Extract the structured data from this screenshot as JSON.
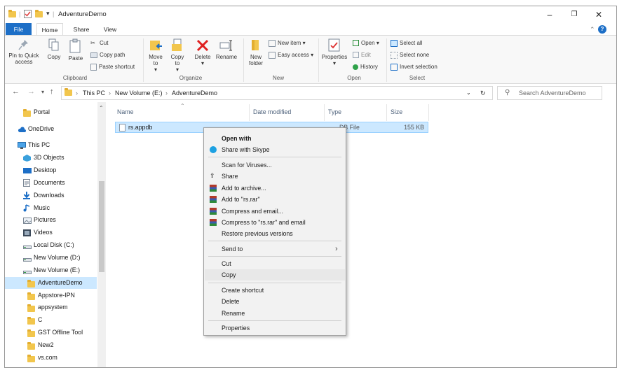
{
  "window": {
    "title": "AdventureDemo",
    "controls": {
      "minimize": "–",
      "maximize": "❐",
      "close": "✕"
    }
  },
  "quick_access": {
    "dropdown": "▾"
  },
  "tabs": {
    "file": "File",
    "home": "Home",
    "share": "Share",
    "view": "View"
  },
  "ribbon": {
    "clipboard": {
      "pin_label": "Pin to Quick access",
      "copy": "Copy",
      "paste": "Paste",
      "cut": "Cut",
      "copy_path": "Copy path",
      "paste_shortcut": "Paste shortcut",
      "group": "Clipboard"
    },
    "organize": {
      "move_to": "Move to",
      "copy_to": "Copy to",
      "delete": "Delete",
      "rename": "Rename",
      "group": "Organize"
    },
    "new": {
      "new_folder": "New folder",
      "new_item": "New item",
      "easy_access": "Easy access",
      "group": "New"
    },
    "open": {
      "properties": "Properties",
      "open": "Open",
      "edit": "Edit",
      "history": "History",
      "group": "Open"
    },
    "select": {
      "select_all": "Select all",
      "select_none": "Select none",
      "invert": "Invert selection",
      "group": "Select"
    }
  },
  "address": {
    "crumbs": [
      "This PC",
      "New Volume (E:)",
      "AdventureDemo"
    ],
    "search_placeholder": "Search AdventureDemo"
  },
  "nav_pane": {
    "items": [
      {
        "label": "Portal",
        "icon": "folder"
      },
      {
        "label": "OneDrive",
        "icon": "cloud"
      },
      {
        "label": "This PC",
        "icon": "computer"
      },
      {
        "label": "3D Objects",
        "icon": "cube"
      },
      {
        "label": "Desktop",
        "icon": "desktop"
      },
      {
        "label": "Documents",
        "icon": "document"
      },
      {
        "label": "Downloads",
        "icon": "download"
      },
      {
        "label": "Music",
        "icon": "music"
      },
      {
        "label": "Pictures",
        "icon": "picture"
      },
      {
        "label": "Videos",
        "icon": "video"
      },
      {
        "label": "Local Disk (C:)",
        "icon": "drive"
      },
      {
        "label": "New Volume (D:)",
        "icon": "drive"
      },
      {
        "label": "New Volume (E:)",
        "icon": "drive"
      },
      {
        "label": "AdventureDemo",
        "icon": "folder",
        "selected": true
      },
      {
        "label": "Appstore-IPN",
        "icon": "folder"
      },
      {
        "label": "appsystem",
        "icon": "folder"
      },
      {
        "label": "C",
        "icon": "folder"
      },
      {
        "label": "GST Offline Tool",
        "icon": "folder"
      },
      {
        "label": "New2",
        "icon": "folder"
      },
      {
        "label": "vs.com",
        "icon": "folder"
      }
    ]
  },
  "file_list": {
    "columns": {
      "name": "Name",
      "date": "Date modified",
      "type": "Type",
      "size": "Size"
    },
    "rows": [
      {
        "name": "rs.appdb",
        "type": "DB File",
        "size": "155 KB"
      }
    ]
  },
  "context_menu": {
    "items": [
      "Open with",
      "Share with Skype",
      "Scan for Viruses...",
      "Share",
      "Add to archive...",
      "Add to \"rs.rar\"",
      "Compress and email...",
      "Compress to \"rs.rar\" and email",
      "Restore previous versions",
      "Send to",
      "Cut",
      "Copy",
      "Create shortcut",
      "Delete",
      "Rename",
      "Properties"
    ]
  },
  "colors": {
    "accent": "#1d6fc7",
    "selection": "#cce8ff",
    "folder": "#f2c64d"
  }
}
